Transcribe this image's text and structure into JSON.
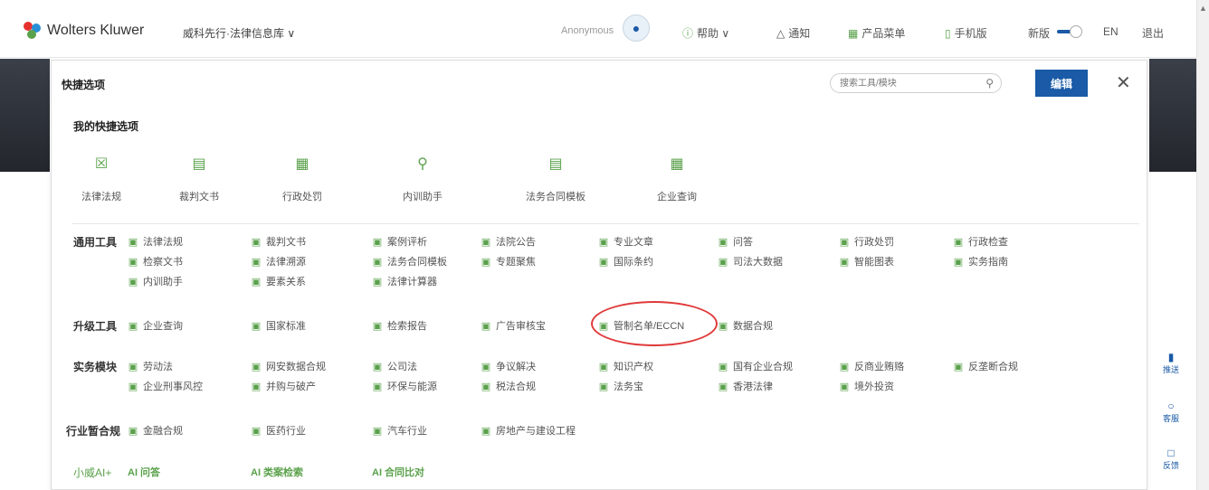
{
  "brand": {
    "name": "Wolters Kluwer",
    "product": "威科先行·法律信息库 ∨"
  },
  "user": {
    "name": "Anonymous"
  },
  "nav": [
    {
      "label": "帮助 ∨",
      "icon": "help-icon"
    },
    {
      "label": "通知",
      "icon": "bell-icon"
    },
    {
      "label": "产品菜单",
      "icon": "grid-icon"
    },
    {
      "label": "手机版",
      "icon": "mobile-icon"
    }
  ],
  "toggle_label": "新版",
  "lang": "EN",
  "logout": "退出",
  "panel": {
    "title": "快捷选项",
    "search_placeholder": "搜索工具/模块",
    "edit_label": "编辑",
    "close": "✕",
    "my_section": "我的快捷选项"
  },
  "quick": [
    {
      "label": "法律法规",
      "icon": "law-icon"
    },
    {
      "label": "裁判文书",
      "icon": "judgment-icon"
    },
    {
      "label": "行政处罚",
      "icon": "penalty-icon"
    },
    {
      "label": "内训助手",
      "icon": "search-icon"
    },
    {
      "label": "法务合同模板",
      "icon": "template-icon"
    },
    {
      "label": "企业查询",
      "icon": "company-icon"
    }
  ],
  "categories": [
    {
      "name": "通用工具",
      "rows": [
        [
          "法律法规",
          "裁判文书",
          "案例评析",
          "法院公告",
          "专业文章",
          "问答",
          "行政处罚",
          "行政检查"
        ],
        [
          "检察文书",
          "法律溯源",
          "法务合同模板",
          "专题聚焦",
          "国际条约",
          "司法大数据",
          "智能图表",
          "实务指南"
        ],
        [
          "内训助手",
          "要素关系",
          "法律计算器"
        ]
      ]
    },
    {
      "name": "升级工具",
      "rows": [
        [
          "企业查询",
          "国家标准",
          "检索报告",
          "广告审核宝",
          "管制名单/ECCN",
          "数据合规"
        ]
      ]
    },
    {
      "name": "实务模块",
      "rows": [
        [
          "劳动法",
          "网安数据合规",
          "公司法",
          "争议解决",
          "知识产权",
          "国有企业合规",
          "反商业贿赂",
          "反垄断合规"
        ],
        [
          "企业刑事风控",
          "并购与破产",
          "环保与能源",
          "税法合规",
          "法务宝",
          "香港法律",
          "境外投资"
        ]
      ]
    },
    {
      "name": "行业暂合规",
      "rows": [
        [
          "金融合规",
          "医药行业",
          "汽车行业",
          "房地产与建设工程"
        ]
      ]
    },
    {
      "name": "小威AI+",
      "rows": [
        [
          "AI 问答",
          "AI 类案检索",
          "AI 合同比对"
        ]
      ]
    }
  ],
  "float": [
    {
      "label": "推送",
      "icon": "bookmark-icon"
    },
    {
      "label": "客服",
      "icon": "headset-icon"
    },
    {
      "label": "反馈",
      "icon": "feedback-icon"
    }
  ],
  "accent": "#1a5aa6",
  "green": "#5aa14b",
  "highlight_color": "#e03a3a"
}
